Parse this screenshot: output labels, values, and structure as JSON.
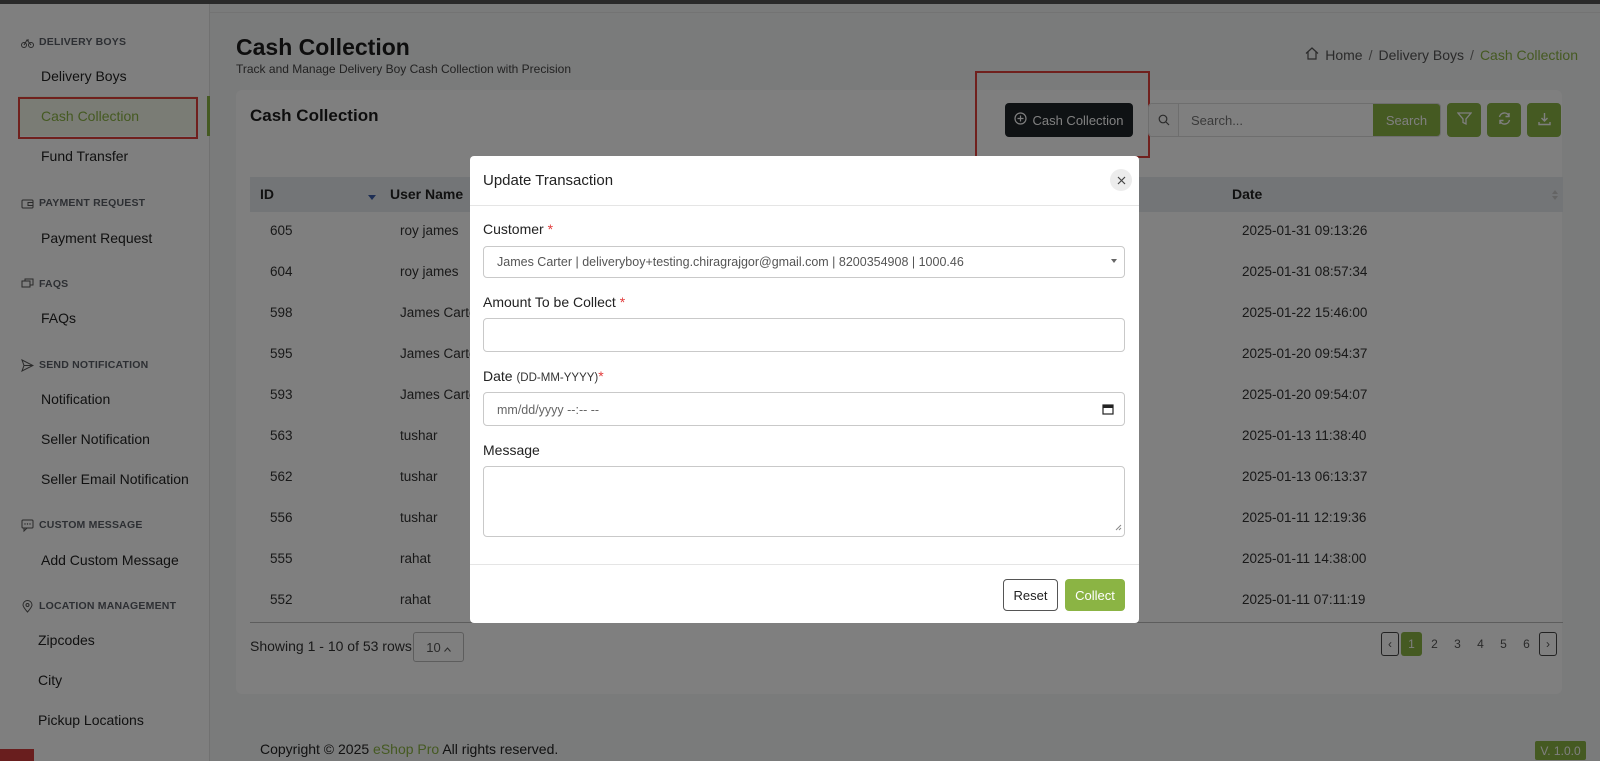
{
  "sidebar": {
    "sections": [
      {
        "label": "DELIVERY BOYS",
        "icon": "bike-icon"
      },
      {
        "label": "PAYMENT REQUEST",
        "icon": "wallet-icon"
      },
      {
        "label": "FAQS",
        "icon": "chat-icon"
      },
      {
        "label": "SEND NOTIFICATION",
        "icon": "send-icon"
      },
      {
        "label": "CUSTOM MESSAGE",
        "icon": "message-icon"
      },
      {
        "label": "LOCATION MANAGEMENT",
        "icon": "location-pin-icon"
      }
    ],
    "items": [
      {
        "label": "Delivery Boys"
      },
      {
        "label": "Cash Collection"
      },
      {
        "label": "Fund Transfer"
      },
      {
        "label": "Payment Request"
      },
      {
        "label": "FAQs"
      },
      {
        "label": "Notification"
      },
      {
        "label": "Seller Notification"
      },
      {
        "label": "Seller Email Notification"
      },
      {
        "label": "Add Custom Message"
      },
      {
        "label": "Zipcodes"
      },
      {
        "label": "City"
      },
      {
        "label": "Pickup Locations"
      }
    ]
  },
  "header": {
    "title": "Cash Collection",
    "subtitle": "Track and Manage Delivery Boy Cash Collection with Precision",
    "breadcrumb": [
      "Home",
      "Delivery Boys",
      "Cash Collection"
    ],
    "separator": "/"
  },
  "card": {
    "title": "Cash Collection",
    "add_button": "Cash Collection",
    "search_placeholder": "Search...",
    "search_button": "Search"
  },
  "table": {
    "headers": {
      "id": "ID",
      "user": "User Name",
      "date": "Date"
    },
    "rows": [
      {
        "id": "605",
        "user": "roy james",
        "date": "2025-01-31 09:13:26"
      },
      {
        "id": "604",
        "user": "roy james",
        "date": "2025-01-31 08:57:34"
      },
      {
        "id": "598",
        "user": "James Carter",
        "date": "2025-01-22 15:46:00"
      },
      {
        "id": "595",
        "user": "James Carter",
        "date": "2025-01-20 09:54:37"
      },
      {
        "id": "593",
        "user": "James Carter",
        "date": "2025-01-20 09:54:07"
      },
      {
        "id": "563",
        "user": "tushar",
        "date": "2025-01-13 11:38:40"
      },
      {
        "id": "562",
        "user": "tushar",
        "date": "2025-01-13 06:13:37"
      },
      {
        "id": "556",
        "user": "tushar",
        "date": "2025-01-11 12:19:36"
      },
      {
        "id": "555",
        "user": "rahat",
        "date": "2025-01-11 14:38:00"
      },
      {
        "id": "552",
        "user": "rahat",
        "date": "2025-01-11 07:11:19"
      }
    ],
    "showing": "Showing 1 - 10 of 53 rows",
    "page_size": "10",
    "pages": [
      "1",
      "2",
      "3",
      "4",
      "5",
      "6"
    ],
    "prev": "‹",
    "next": "›"
  },
  "footer": {
    "copyright_prefix": "Copyright © 2025 ",
    "brand": "eShop Pro",
    "copyright_suffix": " All rights reserved.",
    "version": "V. 1.0.0"
  },
  "modal": {
    "title": "Update Transaction",
    "customer_label": "Customer",
    "customer_value": "James Carter | deliveryboy+testing.chiragrajgor@gmail.com | 8200354908 | 1000.46",
    "amount_label": "Amount To be Collect",
    "date_label": "Date",
    "date_hint": "(DD-MM-YYYY)",
    "date_placeholder": "mm/dd/yyyy --:-- --",
    "message_label": "Message",
    "required_mark": "*",
    "reset_button": "Reset",
    "collect_button": "Collect"
  },
  "colors": {
    "accent": "#8bb444",
    "dark_button": "#1f2429",
    "annotation": "#e0403a"
  }
}
